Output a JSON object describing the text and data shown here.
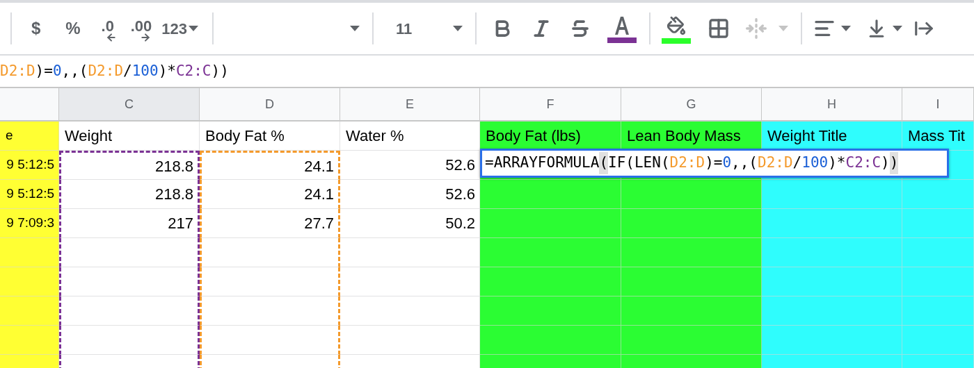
{
  "toolbar": {
    "currency": "$",
    "percent": "%",
    "decrease_decimals": ".0",
    "increase_decimals": ".00",
    "more_formats": "123",
    "font_size": "11",
    "text_color": {
      "color": "#7b3294"
    },
    "fill_color": {
      "color": "#2bff2b"
    },
    "merge_disabled": true
  },
  "formula_bar": {
    "tokens": [
      {
        "text": "D2:D",
        "color": "#f49a2c"
      },
      {
        "text": ")=",
        "color": "#000000"
      },
      {
        "text": "0",
        "color": "#1a5fd6"
      },
      {
        "text": ",,(",
        "color": "#000000"
      },
      {
        "text": "D2:D",
        "color": "#f49a2c"
      },
      {
        "text": "/",
        "color": "#000000"
      },
      {
        "text": "100",
        "color": "#1a5fd6"
      },
      {
        "text": ")*",
        "color": "#000000"
      },
      {
        "text": "C2:C",
        "color": "#7b3294"
      },
      {
        "text": "))",
        "color": "#000000"
      }
    ]
  },
  "columns": [
    {
      "selected": false,
      "color": "#ffff33"
    },
    {
      "letter": "C",
      "selected": true,
      "copy_range": {
        "color": "#7b3294"
      }
    },
    {
      "letter": "D",
      "selected": false,
      "copy_range": {
        "color": "#f49a2c"
      }
    },
    {
      "letter": "E",
      "selected": false
    },
    {
      "letter": "F",
      "selected": false,
      "color": "#2bfd33"
    },
    {
      "letter": "G",
      "selected": false,
      "color": "#2bfd33"
    },
    {
      "letter": "H",
      "selected": false,
      "color": "#2ffdfd"
    },
    {
      "letter": "I",
      "selected": false,
      "color": "#2ffdfd"
    }
  ],
  "rows": [
    [
      "e",
      "Weight",
      "Body Fat %",
      "Water %",
      "Body Fat (lbs)",
      "Lean Body Mass",
      "Weight Title",
      "Mass Tit"
    ],
    [
      "9 5:12:5",
      "218.8",
      "24.1",
      "52.6"
    ],
    [
      "9 5:12:5",
      "218.8",
      "24.1",
      "52.6"
    ],
    [
      "9 7:09:3",
      "217",
      "27.7",
      "50.2"
    ]
  ],
  "cell_editor": {
    "tokens": [
      {
        "text": "=ARRAYFORMULA",
        "color": "#000000",
        "highlighted": false
      },
      {
        "text": "(",
        "color": "#000000",
        "highlighted": true
      },
      {
        "text": "IF(LEN(",
        "color": "#000000",
        "highlighted": false
      },
      {
        "text": "D2:D",
        "color": "#f49a2c",
        "highlighted": false
      },
      {
        "text": ")=",
        "color": "#000000",
        "highlighted": false
      },
      {
        "text": "0",
        "color": "#1a5fd6",
        "highlighted": false
      },
      {
        "text": ",,(",
        "color": "#000000",
        "highlighted": false
      },
      {
        "text": "D2:D",
        "color": "#f49a2c",
        "highlighted": false
      },
      {
        "text": "/",
        "color": "#000000",
        "highlighted": false
      },
      {
        "text": "100",
        "color": "#1a5fd6",
        "highlighted": false
      },
      {
        "text": ")*",
        "color": "#000000",
        "highlighted": false
      },
      {
        "text": "C2:C",
        "color": "#7b3294",
        "highlighted": false
      },
      {
        "text": ")",
        "color": "#000000",
        "highlighted": false
      },
      {
        "text": ")",
        "color": "#000000",
        "highlighted": true
      }
    ]
  }
}
